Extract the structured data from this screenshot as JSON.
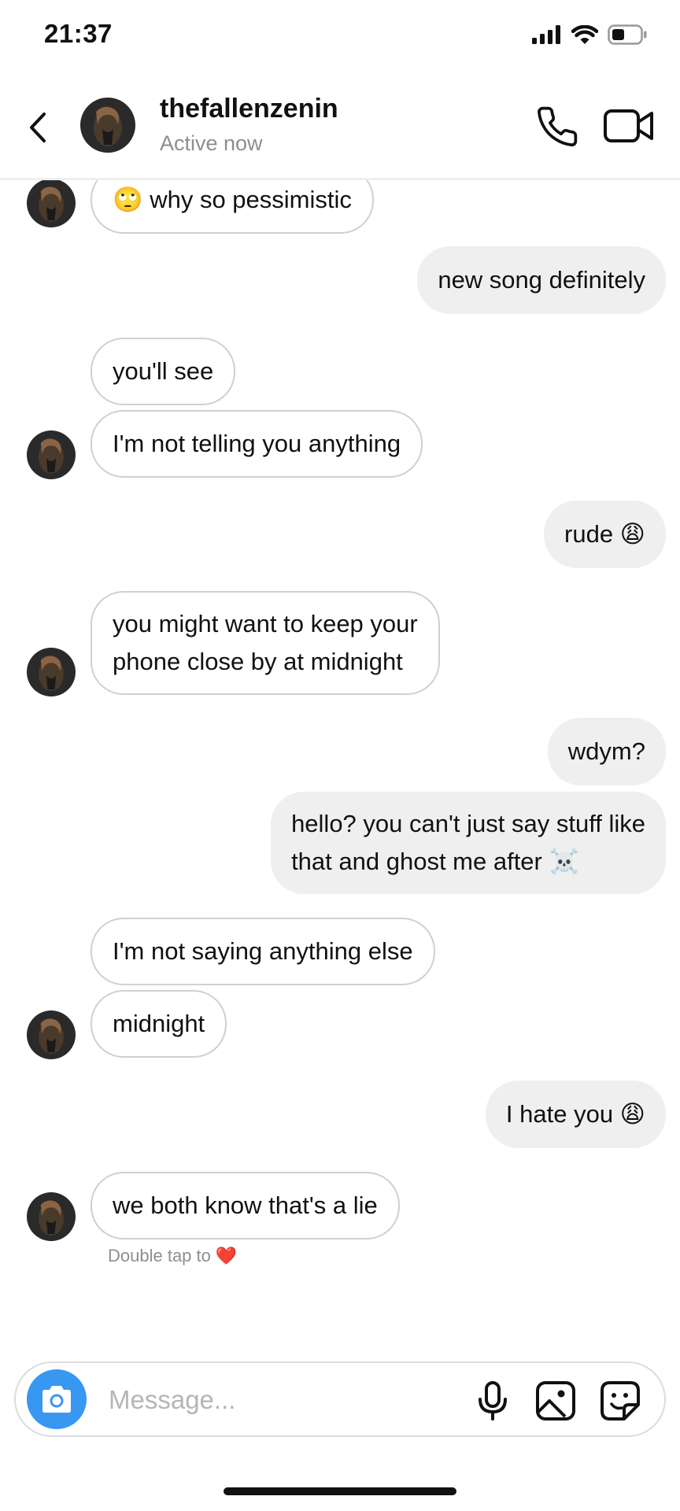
{
  "status_bar": {
    "time": "21:37"
  },
  "header": {
    "username": "thefallenzenin",
    "status": "Active now"
  },
  "messages": [
    {
      "from": "them",
      "lines": [
        "🙄 why so pessimistic"
      ]
    },
    {
      "from": "me",
      "lines": [
        "new song definitely"
      ]
    },
    {
      "from": "them",
      "lines": [
        "you'll see"
      ]
    },
    {
      "from": "them",
      "lines": [
        "I'm not telling you anything"
      ]
    },
    {
      "from": "me",
      "lines": [
        "rude 😩"
      ]
    },
    {
      "from": "them",
      "lines": [
        "you might want to keep your",
        "phone close by at midnight"
      ]
    },
    {
      "from": "me",
      "lines": [
        "wdym?"
      ]
    },
    {
      "from": "me",
      "lines": [
        "hello? you can't just say stuff like",
        "that and ghost me after ☠️"
      ]
    },
    {
      "from": "them",
      "lines": [
        "I'm not saying anything else"
      ]
    },
    {
      "from": "them",
      "lines": [
        "midnight"
      ]
    },
    {
      "from": "me",
      "lines": [
        "I hate you 😩"
      ]
    },
    {
      "from": "them",
      "lines": [
        "we both know that's a lie"
      ]
    }
  ],
  "hint": {
    "text": "Double tap to",
    "heart": "❤️"
  },
  "composer": {
    "placeholder": "Message..."
  },
  "colors": {
    "accent": "#3897f0",
    "incoming_border": "#d0d0d0",
    "outgoing_bg": "#efefef",
    "secondary_text": "#8e8e8e"
  },
  "icons": {
    "back": "chevron-left-icon",
    "call": "phone-icon",
    "video": "video-camera-icon",
    "camera": "camera-icon",
    "mic": "microphone-icon",
    "gallery": "image-icon",
    "sticker": "sticker-icon"
  }
}
